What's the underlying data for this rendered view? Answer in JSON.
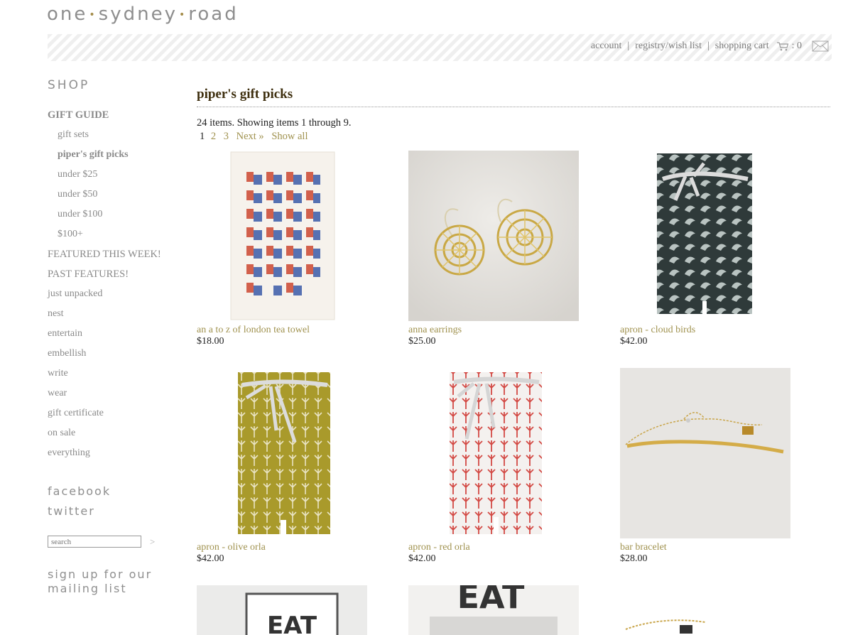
{
  "brand": {
    "part1": "one",
    "part2": "sydney",
    "part3": "road"
  },
  "topnav": {
    "account": "account",
    "registry": "registry/wish list",
    "cart": "shopping cart",
    "cart_count": ": 0",
    "sep": "|"
  },
  "sidebar": {
    "shop": "SHOP",
    "gift_guide": "GIFT GUIDE",
    "sub": [
      {
        "label": "gift sets"
      },
      {
        "label": "piper's gift picks"
      },
      {
        "label": "under $25"
      },
      {
        "label": "under $50"
      },
      {
        "label": "under $100"
      },
      {
        "label": "$100+"
      }
    ],
    "links": [
      {
        "label": "FEATURED THIS WEEK!"
      },
      {
        "label": "PAST FEATURES!"
      },
      {
        "label": "just unpacked"
      },
      {
        "label": "nest"
      },
      {
        "label": "entertain"
      },
      {
        "label": "embellish"
      },
      {
        "label": "write"
      },
      {
        "label": "wear"
      },
      {
        "label": "gift certificate"
      },
      {
        "label": "on sale"
      },
      {
        "label": "everything"
      }
    ],
    "facebook": "facebook",
    "twitter": "twitter",
    "search_placeholder": "search",
    "search_go": ">",
    "signup_line1": "sign up for our",
    "signup_line2": "mailing list"
  },
  "main": {
    "title": "piper's gift picks",
    "summary": "24 items. Showing items 1 through 9.",
    "pager": {
      "current": "1",
      "p2": "2",
      "p3": "3",
      "next": "Next »",
      "all": "Show all"
    },
    "items": [
      {
        "name": "an a to z of london tea towel",
        "price": "$18.00"
      },
      {
        "name": "anna earrings",
        "price": "$25.00"
      },
      {
        "name": "apron - cloud birds",
        "price": "$42.00"
      },
      {
        "name": "apron - olive orla",
        "price": "$42.00"
      },
      {
        "name": "apron - red orla",
        "price": "$42.00"
      },
      {
        "name": "bar bracelet",
        "price": "$28.00"
      }
    ],
    "partial": {
      "eat1": "EAT",
      "eat2": "EAT"
    }
  }
}
